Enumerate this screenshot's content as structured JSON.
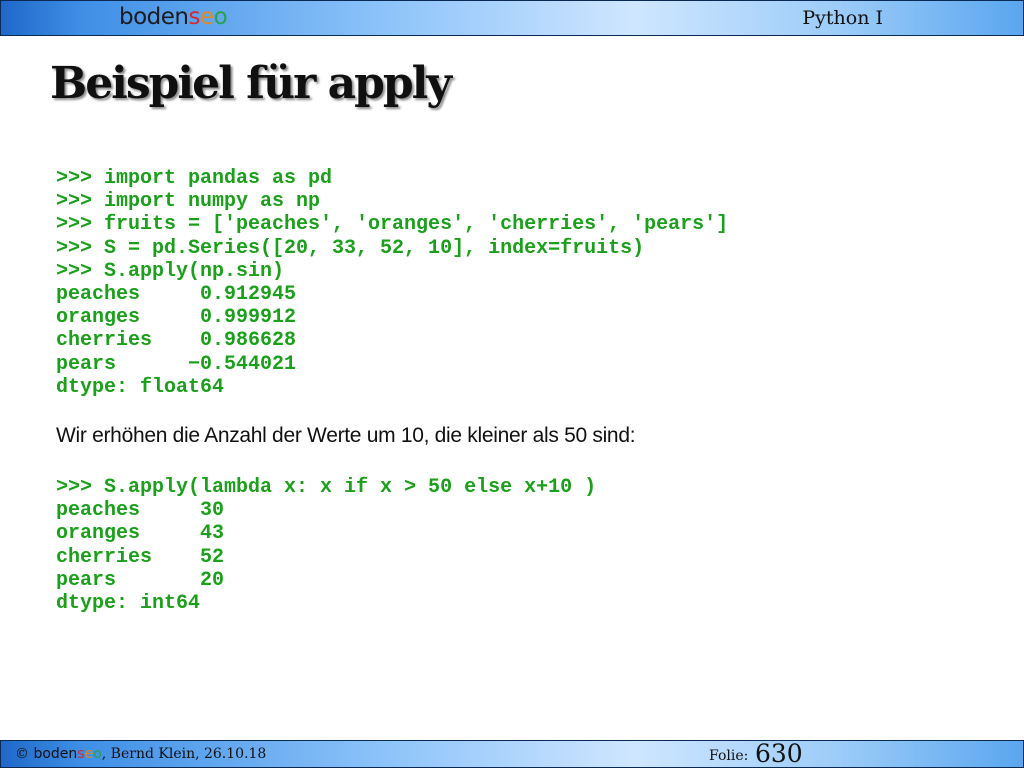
{
  "header": {
    "logo": {
      "prefix": "boden",
      "s": "s",
      "e": "e",
      "o": "o"
    },
    "course": "Python I"
  },
  "slide": {
    "title": "Beispiel für apply",
    "code_block_1": [
      ">>> import pandas as pd",
      ">>> import numpy as np",
      ">>> fruits = ['peaches', 'oranges', 'cherries', 'pears']",
      ">>> S = pd.Series([20, 33, 52, 10], index=fruits)",
      ">>> S.apply(np.sin)",
      "peaches     0.912945",
      "oranges     0.999912",
      "cherries    0.986628",
      "pears      −0.544021",
      "dtype: float64"
    ],
    "caption": "Wir erhöhen die Anzahl der Werte um 10, die kleiner als  50 sind:",
    "code_block_2": [
      ">>> S.apply(lambda x: x if x > 50 else x+10 )",
      "peaches     30",
      "oranges     43",
      "cherries    52",
      "pears       20",
      "dtype: int64"
    ]
  },
  "footer": {
    "copyright": "©",
    "author_date": ", Bernd Klein, 26.10.18",
    "folie_label": "Folie:",
    "slide_number": "630"
  },
  "colors": {
    "code": "#1aa01a",
    "bar_dark": "#1f68c8",
    "bar_light": "#cfe6ff"
  }
}
